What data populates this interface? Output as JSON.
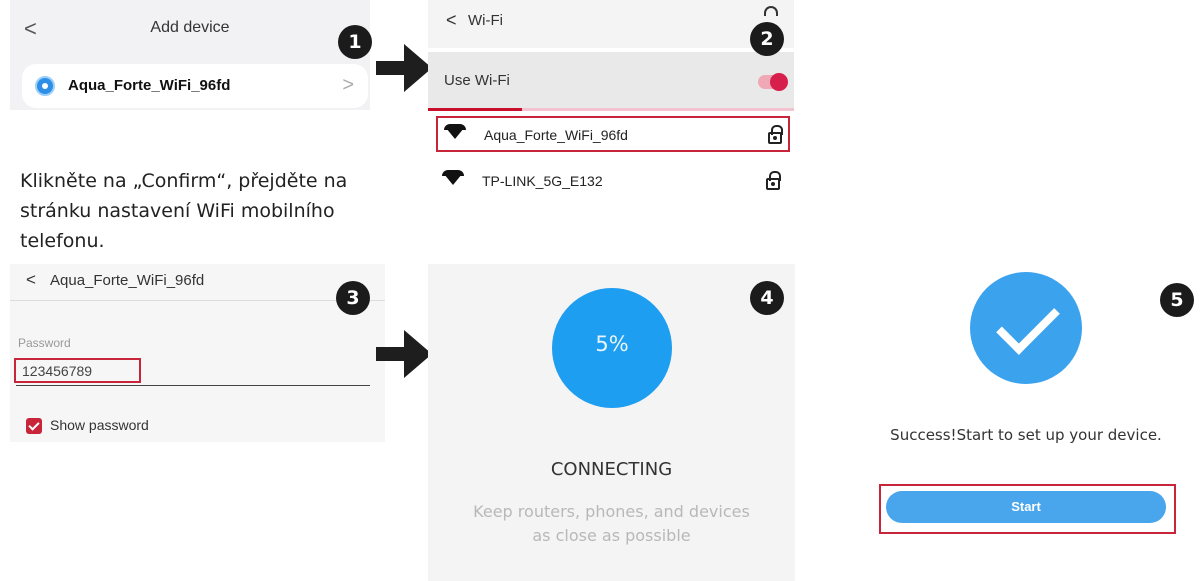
{
  "panel1": {
    "title": "Add device",
    "back_icon": "chevron-left-icon",
    "device_name": "Aqua_Forte_WiFi_96fd"
  },
  "caption": "Klikněte na „Confirm“, přejděte na stránku nastavení WiFi mobilního telefonu.",
  "panel2": {
    "title": "Wi-Fi",
    "use_wifi_label": "Use Wi-Fi",
    "use_wifi_on": true,
    "toggle_color": "#d61f4a",
    "networks": [
      {
        "name": "Aqua_Forte_WiFi_96fd",
        "selected": true
      },
      {
        "name": "TP-LINK_5G_E132",
        "selected": false
      }
    ]
  },
  "panel3": {
    "title": "Aqua_Forte_WiFi_96fd",
    "password_label": "Password",
    "password_value": "123456789",
    "show_password_label": "Show password",
    "show_password_checked": true
  },
  "panel4": {
    "progress_text": "5%",
    "status": "CONNECTING",
    "hint_line1": "Keep routers, phones, and devices",
    "hint_line2": "as close as possible"
  },
  "panel5": {
    "success_text": "Success!Start to set up your device.",
    "start_label": "Start"
  },
  "badges": [
    "1",
    "2",
    "3",
    "4",
    "5"
  ],
  "colors": {
    "highlight_red": "#c8243a",
    "accent_blue": "#1e9ef0"
  }
}
